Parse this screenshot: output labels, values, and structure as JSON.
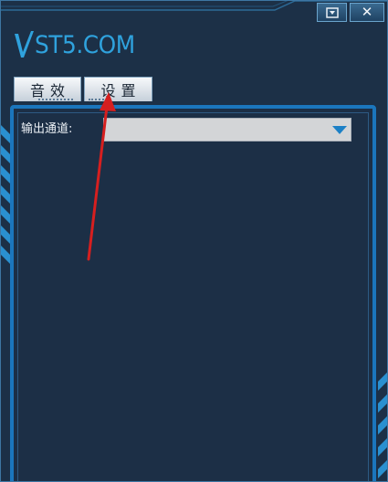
{
  "window": {
    "logo_text": "ST5.COM",
    "minimize_icon": "dropdown-triangle-icon",
    "close_glyph": "✕"
  },
  "tabs": [
    {
      "label": "音效",
      "active": false
    },
    {
      "label": "设置",
      "active": true
    }
  ],
  "settings": {
    "output_channel_label": "输出通道:",
    "output_channel_value": "",
    "arrow_icon": "chevron-down-icon"
  },
  "colors": {
    "logo": "#2fa2dd",
    "panel_border": "#1b76bd",
    "background": "#1c3047",
    "annotation_arrow": "#d61f1f"
  }
}
